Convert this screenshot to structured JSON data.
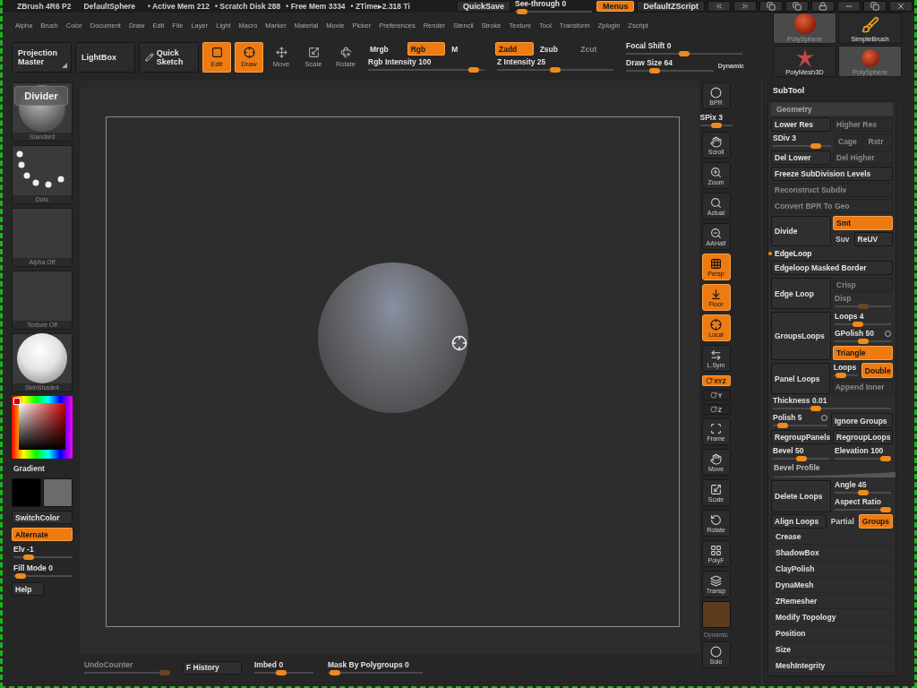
{
  "titlebar": {
    "app": "ZBrush 4R6 P2",
    "document": "DefaultSphere",
    "stats": [
      "• Active Mem 212",
      "• Scratch Disk 288",
      "• Free Mem 3334",
      "• ZTime▸2.318 Ti"
    ],
    "quicksave": {
      "label": "QuickSave",
      "on": false,
      "disabled": false
    },
    "see_through": {
      "label": "See-through",
      "value": "0",
      "level": 0.03,
      "disabled": false
    },
    "menus": {
      "label": "Menus",
      "on": true,
      "disabled": false
    },
    "script": {
      "label": "DefaultZScript",
      "on": false,
      "disabled": false
    }
  },
  "menu": [
    "Alpha",
    "Brush",
    "Color",
    "Document",
    "Draw",
    "Edit",
    "File",
    "Layer",
    "Light",
    "Macro",
    "Marker",
    "Material",
    "Movie",
    "Picker",
    "Preferences",
    "Render",
    "Stencil",
    "Stroke",
    "Texture",
    "Tool",
    "Transform",
    "Zplugin",
    "Zscript"
  ],
  "toolbar": {
    "large": [
      {
        "label": "Projection Master"
      },
      {
        "label": "LightBox"
      },
      {
        "label": "Quick Sketch"
      }
    ],
    "modes": [
      {
        "label": "Edit",
        "on": true,
        "disabled": false
      },
      {
        "label": "Draw",
        "on": true,
        "disabled": false
      },
      {
        "label": "Move",
        "on": false,
        "disabled": false
      },
      {
        "label": "Scale",
        "on": false,
        "disabled": false
      },
      {
        "label": "Rotate",
        "on": false,
        "disabled": false
      }
    ],
    "color_modes": [
      {
        "label": "Mrgb",
        "on": false,
        "disabled": false
      },
      {
        "label": "Rgb",
        "on": true,
        "disabled": false
      },
      {
        "label": "M",
        "on": false,
        "disabled": false
      }
    ],
    "rgb_intensity": {
      "label": "Rgb Intensity",
      "value": "100",
      "level": 0.95,
      "disabled": false
    },
    "z_modes": [
      {
        "label": "Zadd",
        "on": true,
        "disabled": false
      },
      {
        "label": "Zsub",
        "on": false,
        "disabled": false
      },
      {
        "label": "Zcut",
        "on": false,
        "disabled": true
      }
    ],
    "z_intensity": {
      "label": "Z Intensity",
      "value": "25",
      "level": 0.5,
      "disabled": false
    },
    "focal_shift": {
      "label": "Focal Shift",
      "value": "0",
      "level": 0.5,
      "disabled": false
    },
    "draw_size": {
      "label": "Draw Size",
      "value": "64",
      "level": 0.3,
      "disabled": false
    },
    "dynamic": "Dynamic"
  },
  "tools": [
    {
      "label": "PolySphere",
      "selected": true
    },
    {
      "label": "SimpleBrush",
      "selected": false
    },
    {
      "label": "PolyMesh3D",
      "selected": false
    },
    {
      "label": "PolySphere",
      "selected": true
    }
  ],
  "left": {
    "thumbs": [
      {
        "label": "Standard"
      },
      {
        "label": "Dots"
      },
      {
        "label": "Alpha Off"
      },
      {
        "label": "Texture Off"
      },
      {
        "label": "SkinShade4"
      }
    ],
    "divider": "Divider",
    "gradient": "Gradient",
    "swatches": [
      {
        "color": "#000000"
      },
      {
        "color": "#6b6b6b"
      }
    ],
    "switch_color": {
      "label": "SwitchColor",
      "on": false,
      "disabled": false
    },
    "alternate": {
      "label": "Alternate",
      "on": true,
      "disabled": false
    },
    "elevation": {
      "label": "Elv",
      "value": "-1",
      "level": 0.2,
      "disabled": false
    },
    "fill_mode": {
      "label": "Fill Mode",
      "value": "0",
      "level": 0.03,
      "disabled": false
    },
    "help": {
      "label": "Help",
      "on": false,
      "disabled": false
    }
  },
  "shelf": [
    {
      "kind": "button",
      "label": "BPR",
      "on": false,
      "disabled": false
    },
    {
      "kind": "slider",
      "label": "SPix",
      "value": "3",
      "level": 0.5,
      "disabled": false
    },
    {
      "kind": "button",
      "label": "Scroll",
      "on": false,
      "disabled": false
    },
    {
      "kind": "button",
      "label": "Zoom",
      "on": false,
      "disabled": false
    },
    {
      "kind": "button",
      "label": "Actual",
      "on": false,
      "disabled": false
    },
    {
      "kind": "button",
      "label": "AAHalf",
      "on": false,
      "disabled": false
    },
    {
      "kind": "button",
      "label": "Persp",
      "on": true,
      "disabled": false
    },
    {
      "kind": "button",
      "label": "Floor",
      "on": true,
      "disabled": false
    },
    {
      "kind": "button",
      "label": "Local",
      "on": true,
      "disabled": false
    },
    {
      "kind": "button",
      "label": "L.Sym",
      "on": false,
      "disabled": false
    },
    {
      "kind": "small",
      "label": "XYZ",
      "on": true,
      "disabled": false
    },
    {
      "kind": "small",
      "label": "Y",
      "on": false,
      "disabled": false
    },
    {
      "kind": "small",
      "label": "Z",
      "on": false,
      "disabled": false
    },
    {
      "kind": "button",
      "label": "Frame",
      "on": false,
      "disabled": false
    },
    {
      "kind": "button",
      "label": "Move",
      "on": false,
      "disabled": false
    },
    {
      "kind": "button",
      "label": "Scale",
      "on": false,
      "disabled": false
    },
    {
      "kind": "button",
      "label": "Rotate",
      "on": false,
      "disabled": false
    },
    {
      "kind": "button",
      "label": "PolyF",
      "on": false,
      "disabled": false
    },
    {
      "kind": "button",
      "label": "Transp",
      "on": false,
      "disabled": false
    },
    {
      "kind": "swatch"
    },
    {
      "kind": "caption",
      "label": "Dynamic"
    },
    {
      "kind": "button",
      "label": "Solo",
      "on": false,
      "disabled": false
    }
  ],
  "subtool": {
    "title": "SubTool",
    "section": "Geometry",
    "rows": [
      {
        "kind": "line",
        "items": [
          {
            "kind": "button",
            "label": "Lower Res",
            "on": false,
            "disabled": false
          },
          {
            "kind": "button",
            "label": "Higher Res",
            "on": false,
            "disabled": true
          }
        ]
      },
      {
        "kind": "line",
        "items": [
          {
            "kind": "slider",
            "label": "SDiv",
            "value": "3",
            "level": 0.8,
            "disabled": false
          },
          [
            {
              "kind": "button",
              "label": "Cage",
              "on": false,
              "disabled": true
            },
            {
              "kind": "button",
              "label": "Rstr",
              "on": false,
              "disabled": true
            }
          ]
        ]
      },
      {
        "kind": "line",
        "items": [
          {
            "kind": "button",
            "label": "Del Lower",
            "on": false,
            "disabled": false
          },
          {
            "kind": "button",
            "label": "Del Higher",
            "on": false,
            "disabled": true
          }
        ]
      },
      {
        "kind": "line",
        "items": [
          {
            "kind": "button",
            "label": "Freeze SubDivision Levels",
            "on": false,
            "disabled": false
          }
        ]
      },
      {
        "kind": "line",
        "items": [
          {
            "kind": "button",
            "label": "Reconstruct Subdiv",
            "on": false,
            "disabled": true
          }
        ]
      },
      {
        "kind": "line",
        "items": [
          {
            "kind": "button",
            "label": "Convert BPR To Geo",
            "on": false,
            "disabled": true
          }
        ]
      },
      {
        "kind": "split",
        "left": [
          [
            {
              "kind": "button",
              "label": "Divide",
              "on": false,
              "disabled": false
            }
          ]
        ],
        "right": [
          [
            {
              "kind": "button",
              "label": "Smt",
              "on": true,
              "disabled": false
            }
          ],
          [
            {
              "kind": "text",
              "label": "Suv"
            },
            {
              "kind": "button",
              "label": "ReUV",
              "on": false,
              "disabled": false
            }
          ]
        ]
      },
      {
        "kind": "subheading",
        "label": "EdgeLoop"
      },
      {
        "kind": "line",
        "items": [
          {
            "kind": "button",
            "label": "Edgeloop Masked Border",
            "on": false,
            "disabled": false
          }
        ]
      },
      {
        "kind": "split",
        "left": [
          [
            {
              "kind": "button",
              "label": "Edge Loop",
              "on": false,
              "disabled": false
            }
          ]
        ],
        "right": [
          [
            {
              "kind": "button",
              "label": "Crisp",
              "on": false,
              "disabled": true
            }
          ],
          [
            {
              "kind": "slider",
              "label": "Disp",
              "level": 0.5,
              "disabled": true
            }
          ]
        ]
      },
      {
        "kind": "split",
        "left": [
          [
            {
              "kind": "button",
              "label": "GroupsLoops",
              "on": false,
              "disabled": false
            }
          ]
        ],
        "right": [
          [
            {
              "kind": "slider",
              "label": "Loops",
              "value": "4",
              "level": 0.4,
              "disabled": false
            }
          ],
          [
            {
              "kind": "slider",
              "label": "GPolish",
              "value": "50",
              "level": 0.5,
              "disabled": false,
              "ring": true
            }
          ],
          [
            {
              "kind": "button",
              "label": "Triangle",
              "on": true,
              "disabled": false
            }
          ]
        ]
      },
      {
        "kind": "split",
        "left": [
          [
            {
              "kind": "button",
              "label": "Panel Loops",
              "on": false,
              "disabled": false
            }
          ]
        ],
        "right": [
          [
            {
              "kind": "slider",
              "label": "Loops",
              "level": 0.15,
              "disabled": false
            },
            {
              "kind": "button",
              "label": "Double",
              "on": true,
              "disabled": false
            }
          ],
          [
            {
              "kind": "button",
              "label": "Append Inner",
              "on": false,
              "disabled": true
            }
          ]
        ]
      },
      {
        "kind": "line",
        "items": [
          {
            "kind": "slider",
            "label": "Thickness",
            "value": "0.01",
            "level": 0.35,
            "disabled": false
          }
        ]
      },
      {
        "kind": "line",
        "items": [
          {
            "kind": "slider",
            "label": "Polish",
            "value": "5",
            "level": 0.1,
            "disabled": false,
            "ring": true
          },
          {
            "kind": "button",
            "label": "Ignore Groups",
            "on": false,
            "disabled": false
          }
        ]
      },
      {
        "kind": "line",
        "items": [
          {
            "kind": "button",
            "label": "RegroupPanels",
            "on": false,
            "disabled": false
          },
          {
            "kind": "button",
            "label": "RegroupLoops",
            "on": false,
            "disabled": false
          }
        ]
      },
      {
        "kind": "line",
        "items": [
          {
            "kind": "slider",
            "label": "Bevel",
            "value": "50",
            "level": 0.5,
            "disabled": false
          },
          {
            "kind": "slider",
            "label": "Elevation",
            "value": "100",
            "level": 1,
            "disabled": false
          }
        ]
      },
      {
        "kind": "profile",
        "label": "Bevel Profile"
      },
      {
        "kind": "split",
        "left": [
          [
            {
              "kind": "button",
              "label": "Delete Loops",
              "on": false,
              "disabled": false
            }
          ]
        ],
        "right": [
          [
            {
              "kind": "slider",
              "label": "Angle",
              "value": "45",
              "level": 0.5,
              "disabled": false
            }
          ],
          [
            {
              "kind": "slider",
              "label": "Aspect Ratio",
              "level": 1,
              "disabled": false
            }
          ]
        ]
      },
      {
        "kind": "line",
        "items": [
          {
            "kind": "button",
            "label": "Align Loops",
            "on": false,
            "disabled": false
          },
          [
            {
              "kind": "text",
              "label": "Partial"
            },
            {
              "kind": "button",
              "label": "Groups",
              "on": true,
              "disabled": false
            }
          ]
        ]
      },
      {
        "kind": "item",
        "label": "Crease"
      },
      {
        "kind": "item",
        "label": "ShadowBox"
      },
      {
        "kind": "item",
        "label": "ClayPolish"
      },
      {
        "kind": "item",
        "label": "DynaMesh"
      },
      {
        "kind": "item",
        "label": "ZRemesher"
      },
      {
        "kind": "item",
        "label": "Modify Topology"
      },
      {
        "kind": "item",
        "label": "Position"
      },
      {
        "kind": "item",
        "label": "Size"
      },
      {
        "kind": "item",
        "label": "MeshIntegrity"
      }
    ]
  },
  "bottom": [
    {
      "kind": "slider",
      "label": "UndoCounter",
      "level": 1,
      "disabled": true
    },
    {
      "kind": "button",
      "label": "F History",
      "on": false,
      "disabled": false
    },
    {
      "kind": "slider",
      "label": "Imbed",
      "value": "0",
      "level": 0.45,
      "disabled": false
    },
    {
      "kind": "slider",
      "label": "Mask By Polygroups",
      "value": "0",
      "level": 0.02,
      "disabled": false
    }
  ]
}
